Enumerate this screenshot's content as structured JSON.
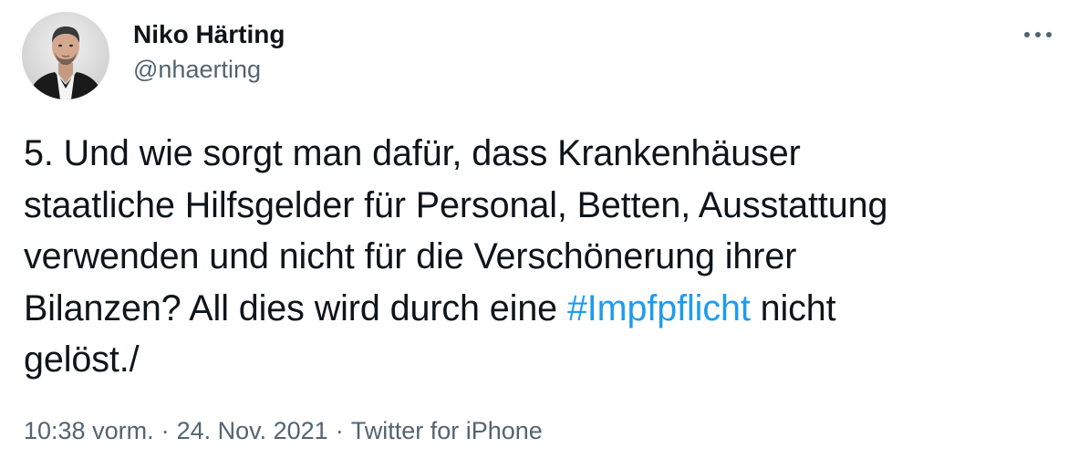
{
  "author": {
    "display_name": "Niko Härting",
    "handle": "@nhaerting"
  },
  "tweet": {
    "lines": [
      {
        "pre": "5. Und wie sorgt man dafür, dass Krankenhäuser"
      },
      {
        "pre": "staatliche Hilfsgelder für Personal, Betten, Ausstattung"
      },
      {
        "pre": "verwenden und nicht für die Verschönerung ihrer"
      },
      {
        "pre": "Bilanzen? All dies wird durch eine ",
        "hashtag": "#Impfpflicht",
        "post": " nicht"
      },
      {
        "pre": "gelöst./"
      }
    ]
  },
  "meta": {
    "time": "10:38 vorm.",
    "separator": "·",
    "date": "24. Nov. 2021",
    "source": "Twitter for iPhone"
  },
  "icons": {
    "more": "more-horizontal-icon",
    "avatar": "avatar-photo"
  },
  "colors": {
    "text": "#0f1419",
    "secondary": "#536471",
    "link": "#1d9bf0"
  }
}
